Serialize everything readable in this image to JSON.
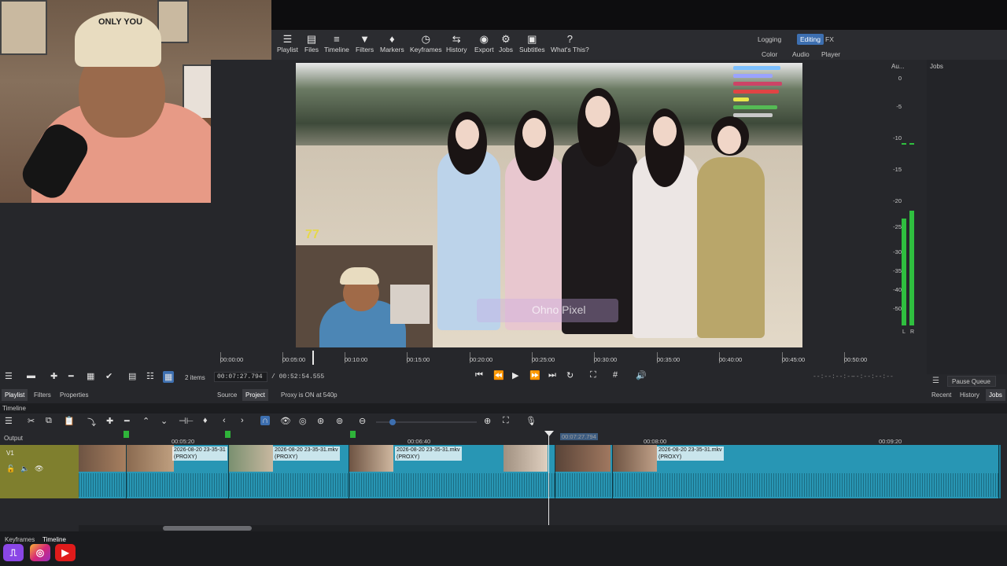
{
  "toolbar": {
    "items": [
      {
        "label": "Playlist",
        "icon": "playlist-icon"
      },
      {
        "label": "Files",
        "icon": "files-icon"
      },
      {
        "label": "Timeline",
        "icon": "timeline-icon"
      },
      {
        "label": "Filters",
        "icon": "filter-icon"
      },
      {
        "label": "Markers",
        "icon": "marker-icon"
      },
      {
        "label": "Keyframes",
        "icon": "stopwatch-icon"
      },
      {
        "label": "History",
        "icon": "history-icon"
      },
      {
        "label": "Export",
        "icon": "export-icon"
      },
      {
        "label": "Jobs",
        "icon": "gear-icon"
      },
      {
        "label": "Subtitles",
        "icon": "subtitles-icon"
      },
      {
        "label": "What's This?",
        "icon": "question-icon"
      }
    ],
    "layouts_row1": [
      "Logging",
      "Editing",
      "FX"
    ],
    "layouts_row2": [
      "Color",
      "Audio",
      "Player"
    ],
    "active_layout": "Editing"
  },
  "webcam": {
    "cap_text": "ONLY YOU"
  },
  "video": {
    "overlay_number": "77",
    "watermark": "Ohno Pixel"
  },
  "audio": {
    "title": "Au...",
    "db_labels": [
      "0",
      "-5",
      "-10",
      "-15",
      "-20",
      "-25",
      "-30",
      "-35",
      "-40",
      "-50"
    ],
    "channels": [
      "L",
      "R"
    ]
  },
  "jobs": {
    "title": "Jobs",
    "pause_queue": "Pause Queue",
    "tabs": [
      "Recent",
      "History",
      "Jobs"
    ]
  },
  "scrubber": {
    "ticks": [
      "00:00:00",
      "00:05:00",
      "00:10:00",
      "00:15:00",
      "00:20:00",
      "00:25:00",
      "00:30:00",
      "00:35:00",
      "00:40:00",
      "00:45:00",
      "00:50:00"
    ]
  },
  "transport": {
    "position": "00:07:27.794",
    "duration": "/ 00:52:54.555",
    "in_point": "--:--:--:--",
    "out_point": "--:--:--:--"
  },
  "playlist": {
    "items_count": "2 items",
    "tabs": [
      "Playlist",
      "Filters",
      "Properties"
    ]
  },
  "source_tabs": [
    "Source",
    "Project"
  ],
  "proxy_status": "Proxy is ON at 540p",
  "timeline": {
    "title": "Timeline",
    "output_label": "Output",
    "track_name": "V1",
    "ruler_labels": [
      "00:05:20",
      "00:06:40",
      "00:08:00",
      "00:09:20"
    ],
    "playhead_time": "00:07:27.794",
    "clips": [
      {
        "name": ""
      },
      {
        "name": "2026-08-20 23-35-31\n(PROXY)"
      },
      {
        "name": "2026-08-20 23-35-31.mkv\n(PROXY)"
      },
      {
        "name": "2026-08-20 23-35-31.mkv\n(PROXY)"
      },
      {
        "name": ""
      },
      {
        "name": ""
      },
      {
        "name": "2026-08-20 23-35-31.mkv\n(PROXY)"
      }
    ],
    "bottom_tabs": [
      "Keyframes",
      "Timeline"
    ]
  },
  "colors": {
    "accent": "#3d6fb0",
    "clip": "#2896b4",
    "track_head": "#7f7f2e",
    "meter": "#2fbf3f"
  }
}
